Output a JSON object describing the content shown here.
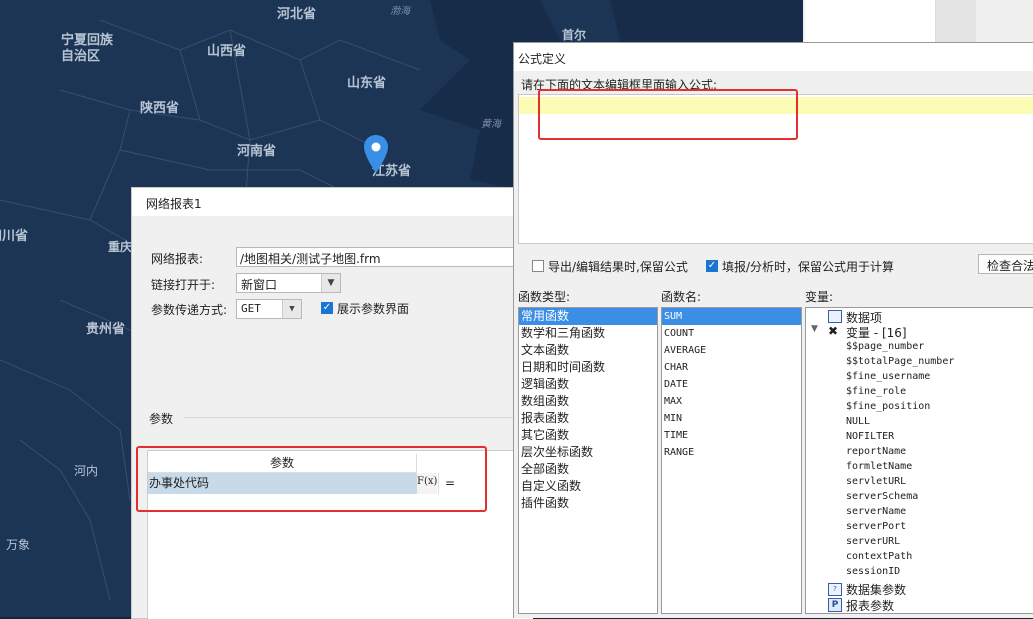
{
  "map": {
    "labels": [
      "河北省",
      "渤海",
      "首尔",
      "宁夏回族自治区",
      "山西省",
      "山东省",
      "陕西省",
      "河南省",
      "黄海",
      "江苏省",
      "四川省",
      "重庆",
      "贵州省",
      "河内",
      "万象"
    ],
    "marker_icon": "map-pin-icon",
    "water_color": "#162c49",
    "land_color": "#1c3554",
    "pin_color": "#3a8ee6"
  },
  "net_dialog": {
    "title": "网络报表1",
    "report_label": "网络报表:",
    "report_value": "/地图相关/测试子地图.frm",
    "link_open_label": "链接打开于:",
    "link_open_value": "新窗口",
    "param_method_label": "参数传递方式:",
    "param_method_value": "GET",
    "show_params_label": "展示参数界面",
    "params_section_label": "参数",
    "table": {
      "header": "参数",
      "row_name": "办事处代码",
      "formula_icon_text": "F(x)",
      "row_value": "="
    }
  },
  "formula_dialog": {
    "title": "公式定义",
    "prompt": "请在下面的文本编辑框里面输入公式:",
    "editor_value": "",
    "keep_formula_export_label": "导出/编辑结果时,保留公式",
    "keep_formula_fill_label": "填报/分析时，保留公式用于计算",
    "check_button": "检查合法",
    "func_type_header": "函数类型:",
    "func_name_header": "函数名:",
    "variable_header": "变量:",
    "func_types": [
      "常用函数",
      "数学和三角函数",
      "文本函数",
      "日期和时间函数",
      "逻辑函数",
      "数组函数",
      "报表函数",
      "其它函数",
      "层次坐标函数",
      "全部函数",
      "自定义函数",
      "插件函数"
    ],
    "func_names": [
      "SUM",
      "COUNT",
      "AVERAGE",
      "CHAR",
      "DATE",
      "MAX",
      "MIN",
      "TIME",
      "RANGE"
    ],
    "variables": {
      "data_items": "数据项",
      "variables_node": "变量 - [16]",
      "variable_items": [
        "$$page_number",
        "$$totalPage_number",
        "$fine_username",
        "$fine_role",
        "$fine_position",
        "NULL",
        "NOFILTER",
        "reportName",
        "formletName",
        "servletURL",
        "serverSchema",
        "serverName",
        "serverPort",
        "serverURL",
        "contextPath",
        "sessionID"
      ],
      "dataset_params": "数据集参数",
      "report_params": "报表参数"
    }
  },
  "colors": {
    "selection": "#3a8ee6",
    "highlight_line": "#fdfcb5",
    "annotation_red": "#e23030",
    "checkbox_on": "#1b76d1"
  }
}
